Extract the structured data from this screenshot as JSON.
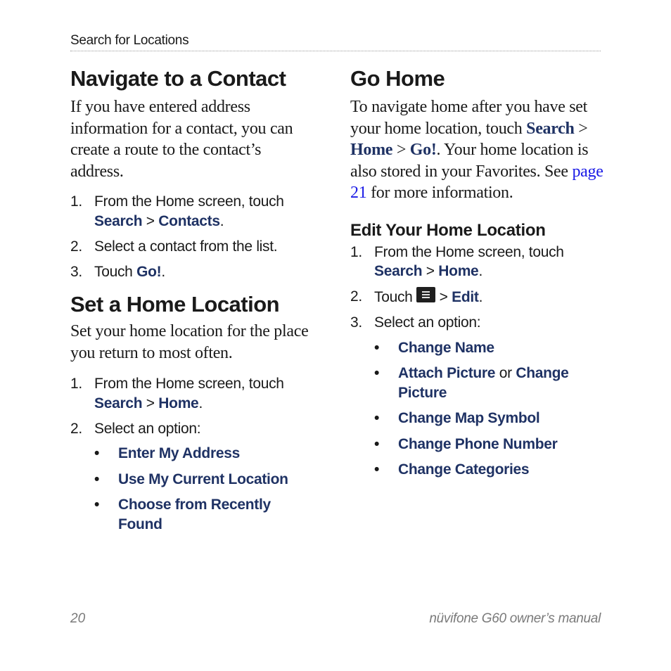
{
  "header": {
    "section_title": "Search for Locations"
  },
  "left_column": {
    "navigate_contact": {
      "title": "Navigate to a Contact",
      "intro": "If you have entered address information for a contact, you can create a route to the contact’s address.",
      "steps": [
        {
          "num": "1.",
          "text": "From the Home screen, touch ",
          "kw1": "Search",
          "sep": " > ",
          "kw2": "Contacts",
          "end": "."
        },
        {
          "num": "2.",
          "text": "Select a contact from the list."
        },
        {
          "num": "3.",
          "text": "Touch ",
          "kw1": "Go!",
          "end": "."
        }
      ]
    },
    "set_home": {
      "title": "Set a Home Location",
      "intro": "Set your home location for the place you return to most often.",
      "steps": [
        {
          "num": "1.",
          "text": "From the Home screen, touch ",
          "kw1": "Search",
          "sep": " > ",
          "kw2": "Home",
          "end": "."
        },
        {
          "num": "2.",
          "text": "Select an option:"
        }
      ],
      "options": [
        "Enter My Address",
        "Use My Current Location",
        "Choose from Recently Found"
      ]
    }
  },
  "right_column": {
    "go_home": {
      "title": "Go Home",
      "intro_1": "To navigate home after you have set your home location, touch ",
      "kw_search": "Search",
      "sep1": " > ",
      "kw_home": "Home",
      "sep2": " > ",
      "kw_go": "Go!",
      "intro_2": ". Your home location is also stored in your Favorites. See ",
      "link_text": "page 21",
      "intro_3": " for more information."
    },
    "edit_home": {
      "title": "Edit Your Home Location",
      "steps": [
        {
          "num": "1.",
          "text": "From the Home screen, touch ",
          "kw1": "Search",
          "sep": " > ",
          "kw2": "Home",
          "end": "."
        },
        {
          "num": "2.",
          "text": "Touch ",
          "icon": "menu-icon",
          "sep": " > ",
          "kw1": "Edit",
          "end": "."
        },
        {
          "num": "3.",
          "text": "Select an option:"
        }
      ],
      "options": [
        {
          "label": "Change Name"
        },
        {
          "label": "Attach Picture",
          "connector": " or ",
          "label2": "Change Picture"
        },
        {
          "label": "Change Map Symbol"
        },
        {
          "label": "Change Phone Number"
        },
        {
          "label": "Change Categories"
        }
      ]
    }
  },
  "footer": {
    "page_number": "20",
    "manual_title": "nüvifone G60 owner’s manual"
  },
  "colors": {
    "keyword": "#1f3264",
    "link": "#1a1ae6",
    "footer": "#7a7a7a"
  }
}
